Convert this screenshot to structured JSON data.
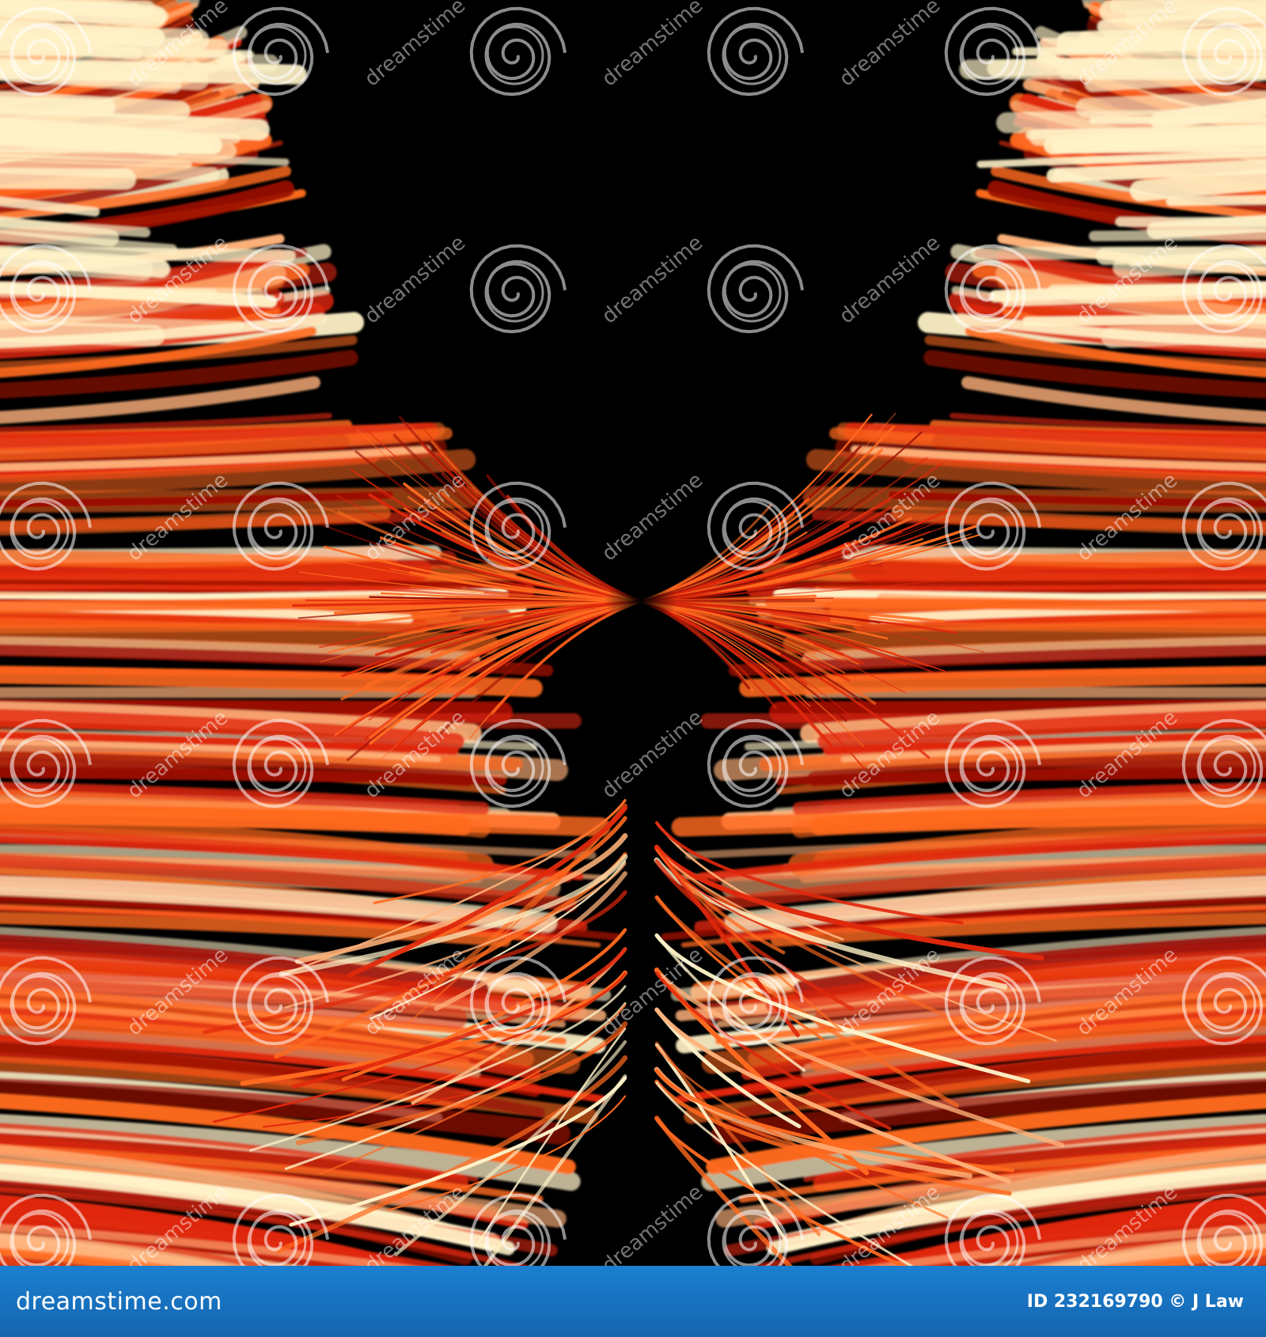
{
  "artwork": {
    "subject": "abstract fiery butterfly",
    "colors": {
      "background": "#000000",
      "deep_red": "#9a0e04",
      "red": "#e0280c",
      "orange": "#ff6a1f",
      "peach": "#ffb27a",
      "cream": "#fff2c8"
    }
  },
  "watermark": {
    "text": "dreamstime",
    "icon": "spiral-logo-icon"
  },
  "footer": {
    "logo_prefix": "dreamstime",
    "logo_suffix": ".com",
    "credit": "ID 232169790 © J Law",
    "background": "#1b7fd1",
    "text_color": "#ffffff"
  }
}
